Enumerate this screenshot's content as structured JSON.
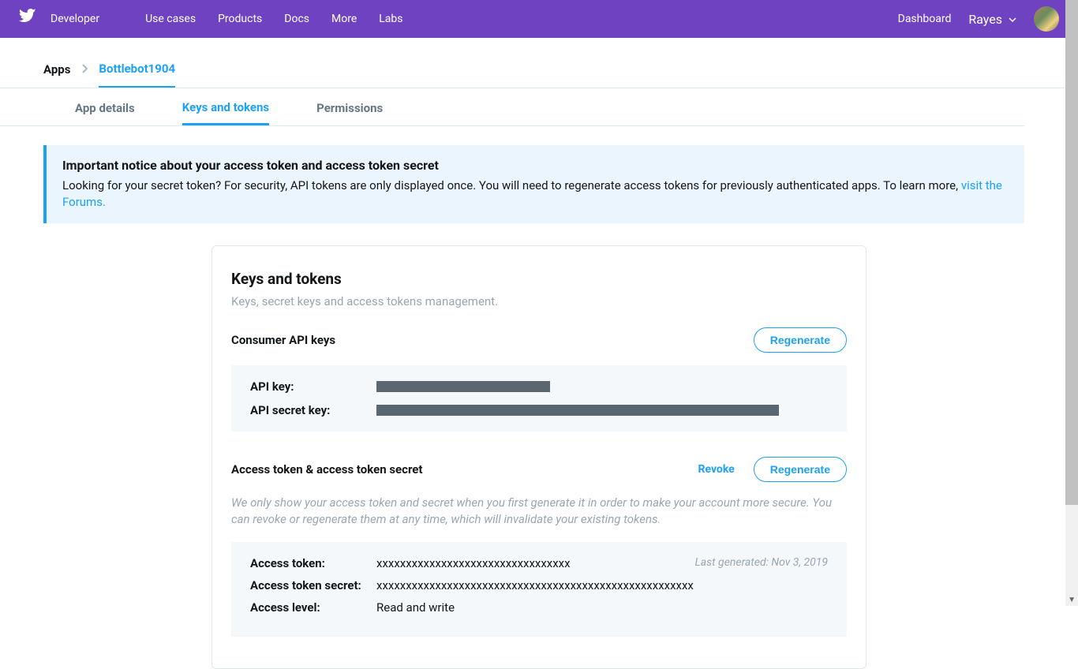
{
  "nav": {
    "brand": "Developer",
    "links": [
      "Use cases",
      "Products",
      "Docs",
      "More",
      "Labs"
    ],
    "dashboard": "Dashboard",
    "user": "Rayes"
  },
  "breadcrumb": {
    "root": "Apps",
    "app": "Bottlebot1904"
  },
  "tabs": [
    "App details",
    "Keys and tokens",
    "Permissions"
  ],
  "notice": {
    "title": "Important notice about your access token and access token secret",
    "body": "Looking for your secret token? For security, API tokens are only displayed once. You will need to regenerate access tokens for previously authenticated apps. To learn more, ",
    "link": "visit the Forums."
  },
  "card": {
    "title": "Keys and tokens",
    "sub": "Keys, secret keys and access tokens management.",
    "consumer": {
      "title": "Consumer API keys",
      "regenerate": "Regenerate",
      "api_key_label": "API key:",
      "api_secret_label": "API secret key:"
    },
    "access": {
      "title": "Access token & access token secret",
      "revoke": "Revoke",
      "regenerate": "Regenerate",
      "note": "We only show your access token and secret when you first generate it in order to make your account more secure. You can revoke or regenerate them at any time, which will invalidate your existing tokens.",
      "token_label": "Access token:",
      "token_val": "xxxxxxxxxxxxxxxxxxxxxxxxxxxxxxxxx",
      "secret_label": "Access token secret:",
      "secret_val": "xxxxxxxxxxxxxxxxxxxxxxxxxxxxxxxxxxxxxxxxxxxxxxxxxxxxxx",
      "level_label": "Access level:",
      "level_val": "Read and write",
      "last_gen": "Last generated: Nov 3, 2019"
    }
  }
}
